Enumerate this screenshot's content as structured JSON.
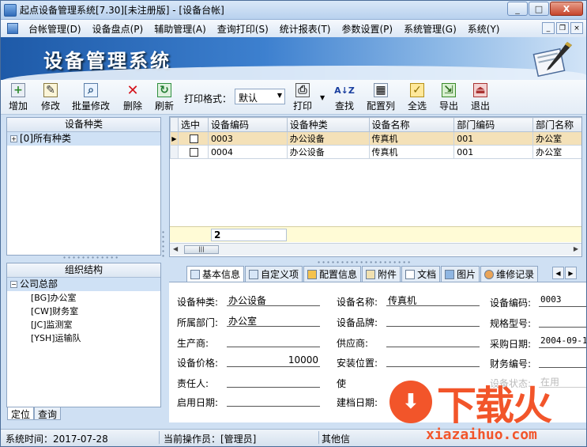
{
  "window": {
    "title": "起点设备管理系统[7.30][未注册版] - [设备台帐]",
    "controls": [
      "_",
      "□",
      "X"
    ]
  },
  "menubar": {
    "items": [
      "台帐管理(D)",
      "设备盘点(P)",
      "辅助管理(A)",
      "查询打印(S)",
      "统计报表(T)",
      "参数设置(P)",
      "系统管理(G)",
      "系统(Y)"
    ],
    "mdi_controls": [
      "_",
      "❐",
      "×"
    ]
  },
  "banner": {
    "title": "设备管理系统"
  },
  "toolbar": {
    "add": "增加",
    "edit": "修改",
    "batch_edit": "批量修改",
    "delete": "删除",
    "refresh": "刷新",
    "print_format_label": "打印格式：",
    "print_format_value": "默认",
    "print": "打印",
    "find": "查找",
    "columns": "配置列",
    "select_all": "全选",
    "export": "导出",
    "exit": "退出"
  },
  "category_pane": {
    "title": "设备种类",
    "root": "[0]所有种类"
  },
  "org_pane": {
    "title": "组织结构",
    "root": "公司总部",
    "children": [
      "[BG]办公室",
      "[CW]财务室",
      "[JC]监测室",
      "[YSH]运输队"
    ]
  },
  "left_tabs": [
    "定位",
    "查询"
  ],
  "grid": {
    "columns": [
      "选中",
      "设备编码",
      "设备种类",
      "设备名称",
      "部门编码",
      "部门名称"
    ],
    "rows": [
      {
        "code": "0003",
        "category": "办公设备",
        "name": "传真机",
        "dept_code": "001",
        "dept_name": "办公室"
      },
      {
        "code": "0004",
        "category": "办公设备",
        "name": "传真机",
        "dept_code": "001",
        "dept_name": "办公室"
      }
    ],
    "footer_count": "2"
  },
  "detail_tabs": [
    "基本信息",
    "自定义项",
    "配置信息",
    "附件",
    "文档",
    "图片",
    "维修记录"
  ],
  "detail": {
    "labels": {
      "category": "设备种类:",
      "name": "设备名称:",
      "code": "设备编码:",
      "dept": "所属部门:",
      "brand": "设备品牌:",
      "spec": "规格型号:",
      "maker": "生产商:",
      "supplier": "供应商:",
      "purchase_date": "采购日期:",
      "price": "设备价格:",
      "location": "安装位置:",
      "finance_no": "财务编号:",
      "owner": "责任人:",
      "user": "使",
      "status": "设备状态:",
      "start_date": "启用日期:",
      "build_date": "建档日期:"
    },
    "values": {
      "category": "办公设备",
      "name": "传真机",
      "code": "0003",
      "dept": "办公室",
      "purchase_date": "2004-09-1",
      "price": "10000",
      "status": "在用"
    }
  },
  "statusbar": {
    "system_time": "系统时间：2017-07-28",
    "operator": "当前操作员：[管理员]",
    "other": "其他信"
  },
  "watermark": {
    "text": "下载火",
    "url": "xiazaihuo.com"
  }
}
